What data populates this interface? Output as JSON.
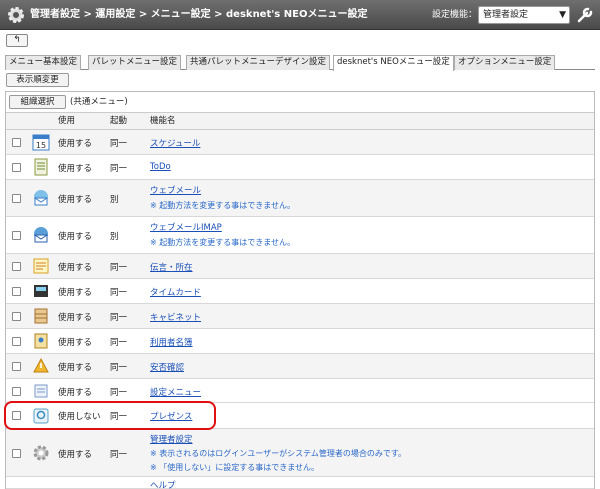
{
  "header": {
    "breadcrumb": "管理者設定 > 運用設定 > メニュー設定 > desknet's NEOメニュー設定",
    "setting_label": "設定機能：",
    "setting_value": "管理者設定"
  },
  "back_button": "↰",
  "tabs": [
    {
      "label": "メニュー基本設定"
    },
    {
      "label": "パレットメニュー設定"
    },
    {
      "label": "共通パレットメニューデザイン設定"
    },
    {
      "label": "desknet's NEOメニュー設定"
    },
    {
      "label": "オプションメニュー設定"
    }
  ],
  "order_button": "表示順変更",
  "org_button": "組織選択",
  "org_label": "(共通メニュー)",
  "table": {
    "headers": {
      "use": "使用",
      "launch": "起動",
      "name": "機能名"
    },
    "rows": [
      {
        "use": "使用する",
        "launch": "同一",
        "name": "スケジュール",
        "icon": "calendar-icon"
      },
      {
        "use": "使用する",
        "launch": "同一",
        "name": "ToDo",
        "icon": "todo-icon"
      },
      {
        "use": "使用する",
        "launch": "別",
        "name": "ウェブメール",
        "note": "※ 起動方法を変更する事はできません。",
        "icon": "webmail-icon"
      },
      {
        "use": "使用する",
        "launch": "別",
        "name": "ウェブメールIMAP",
        "note": "※ 起動方法を変更する事はできません。",
        "icon": "webmail-imap-icon"
      },
      {
        "use": "使用する",
        "launch": "同一",
        "name": "伝言・所在",
        "icon": "message-icon"
      },
      {
        "use": "使用する",
        "launch": "同一",
        "name": "タイムカード",
        "icon": "timecard-icon"
      },
      {
        "use": "使用する",
        "launch": "同一",
        "name": "キャビネット",
        "icon": "cabinet-icon"
      },
      {
        "use": "使用する",
        "launch": "同一",
        "name": "利用者名簿",
        "icon": "directory-icon"
      },
      {
        "use": "使用する",
        "launch": "同一",
        "name": "安否確認",
        "icon": "safety-icon"
      },
      {
        "use": "使用する",
        "launch": "同一",
        "name": "設定メニュー",
        "icon": "settings-menu-icon"
      },
      {
        "use": "使用しない",
        "launch": "同一",
        "name": "プレゼンス",
        "icon": "presence-icon"
      },
      {
        "use": "使用する",
        "launch": "同一",
        "name": "管理者設定",
        "note": "※ 表示されるのはログインユーザーがシステム管理者の場合のみです。",
        "note2": "※ 「使用しない」に設定する事はできません。",
        "icon": "admin-gear-icon"
      },
      {
        "name": "ヘルプ"
      }
    ]
  },
  "colors": {
    "highlight": "#e01010",
    "link": "#1a4fb8",
    "header_bg": "#555555"
  }
}
